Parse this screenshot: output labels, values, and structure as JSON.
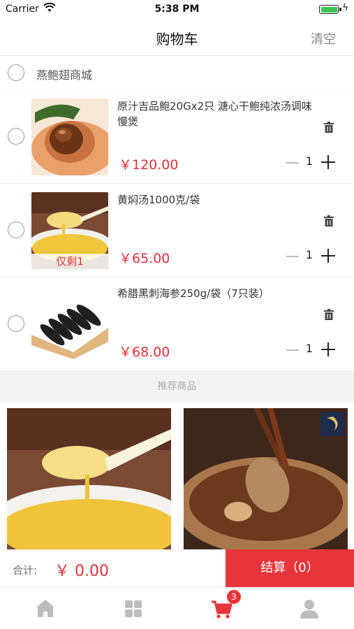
{
  "status_bar": {
    "carrier": "Carrier",
    "time": "5:38 PM"
  },
  "nav": {
    "title": "购物车",
    "clear_label": "清空"
  },
  "shop": {
    "name": "燕鲍翅商城"
  },
  "items": [
    {
      "name": "原汁吉品鲍20Gx2只 溏心干鲍纯浓汤调味慢煲",
      "price": "￥120.00",
      "qty": "1",
      "image": "abalone-dish",
      "note": ""
    },
    {
      "name": "黄焖汤1000克/袋",
      "price": "￥65.00",
      "qty": "1",
      "image": "golden-soup-spoon",
      "note": "仅剩1"
    },
    {
      "name": "希腊黑刺海参250g/袋（7只装）",
      "price": "￥68.00",
      "qty": "1",
      "image": "sea-cucumbers",
      "note": ""
    }
  ],
  "recommend": {
    "title": "推荐商品",
    "products": [
      {
        "image": "golden-soup-spoon"
      },
      {
        "image": "abalone-claypot"
      }
    ]
  },
  "footer": {
    "total_label": "合计:",
    "total_amount": "￥ 0.00",
    "checkout_label": "结算（0）"
  },
  "tabbar": {
    "tabs": [
      "home-icon",
      "category-grid-icon",
      "cart-icon",
      "profile-icon"
    ],
    "cart_badge": "3",
    "active_color": "#e8353c"
  },
  "colors": {
    "accent": "#e8353c",
    "price": "#e0323a"
  }
}
